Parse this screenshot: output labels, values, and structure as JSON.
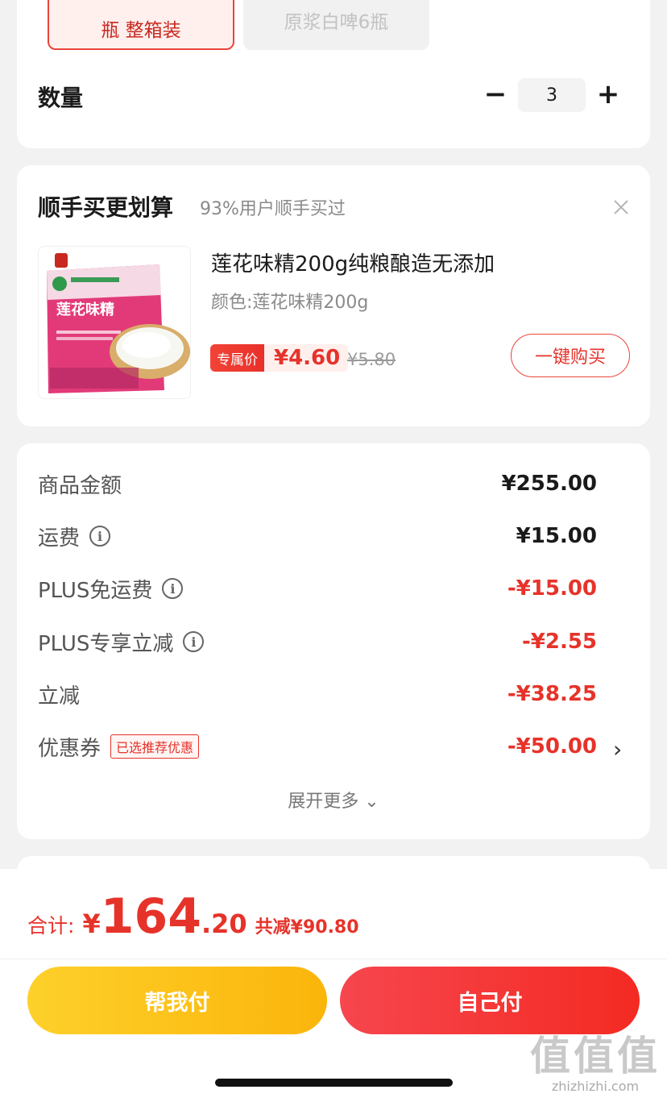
{
  "spec": {
    "selected_option": "瓶 整箱装",
    "disabled_option": "原浆白啤6瓶"
  },
  "quantity": {
    "label": "数量",
    "minus": "−",
    "plus": "+",
    "value": "3"
  },
  "addon": {
    "title": "顺手买更划算",
    "subtitle": "93%用户顺手买过",
    "close": "×",
    "product": {
      "name": "莲花味精200g纯粮酿造无添加",
      "spec": "颜色:莲花味精200g",
      "price_label": "专属价",
      "price": "¥4.60",
      "original_price": "¥5.80",
      "buy_button": "一键购买",
      "package_brand": "莲花味精"
    }
  },
  "price_breakdown": {
    "rows": [
      {
        "label": "商品金额",
        "amount": "¥255.00"
      },
      {
        "label": "运费",
        "amount": "¥15.00"
      },
      {
        "label": "PLUS免运费",
        "amount": "-¥15.00"
      },
      {
        "label": "PLUS专享立减",
        "amount": "-¥2.55"
      },
      {
        "label": "立减",
        "amount": "-¥38.25"
      },
      {
        "label": "优惠券",
        "badge": "已选推荐优惠",
        "amount": "-¥50.00"
      }
    ],
    "expand_more": "展开更多 ⌄"
  },
  "bottom": {
    "total_label": "合计:",
    "currency": "¥",
    "total_int": "164",
    "total_dec": ".20",
    "savings": "共减¥90.80",
    "help_pay": "帮我付",
    "self_pay": "自己付"
  },
  "watermark": {
    "logo": "值值值",
    "url": "zhizhizhi.com"
  },
  "colors": {
    "accent_red": "#e6332a",
    "help_yellow": "#fdc21a",
    "self_red": "#f53a36"
  }
}
